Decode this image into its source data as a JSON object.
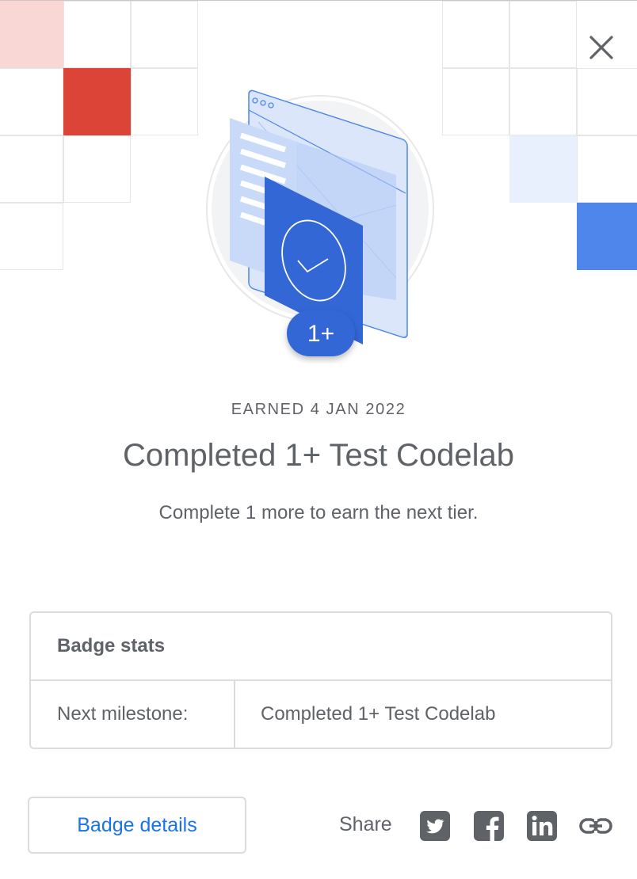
{
  "badge": {
    "tier": "1+",
    "earned": "EARNED 4 JAN 2022",
    "title": "Completed 1+ Test Codelab",
    "subtitle": "Complete 1 more to earn the next tier."
  },
  "stats": {
    "heading": "Badge stats",
    "rows": [
      {
        "label": "Next milestone:",
        "value": "Completed 1+ Test Codelab"
      }
    ]
  },
  "actions": {
    "details_label": "Badge details",
    "share_label": "Share",
    "share_icons": [
      "twitter-icon",
      "facebook-icon",
      "linkedin-icon",
      "link-icon"
    ]
  },
  "colors": {
    "accent": "#1a73e8",
    "badge_blue": "#3367d6",
    "tile_red": "#db4437",
    "tile_pink": "#f8d7d5",
    "tile_blue": "#4f86ec",
    "tile_light_blue": "#e8f0fe"
  }
}
